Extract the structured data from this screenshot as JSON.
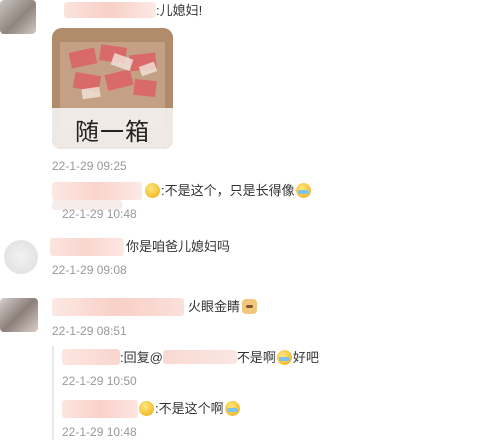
{
  "comments": [
    {
      "text_suffix": ":儿媳妇!",
      "image_caption": "随一箱",
      "time": "22-1-29 09:25"
    },
    {
      "text": ":不是这个，只是长得像",
      "time": "22-1-29 10:48"
    },
    {
      "text": "你是咱爸儿媳妇吗",
      "time": "22-1-29 09:08"
    },
    {
      "text": "火眼金睛",
      "time": "22-1-29 08:51",
      "replies": [
        {
          "prefix": ":回复@",
          "mid": "不是啊",
          "suffix": "好吧",
          "time": "22-1-29 10:50"
        },
        {
          "text": ":不是这个啊",
          "time": "22-1-29 10:48"
        }
      ]
    }
  ],
  "colors": {
    "timestamp": "#999999",
    "text": "#333333",
    "mention": "#eb7350"
  },
  "icons": [
    "cry-laugh-emoji-icon",
    "doge-emoji-icon"
  ]
}
